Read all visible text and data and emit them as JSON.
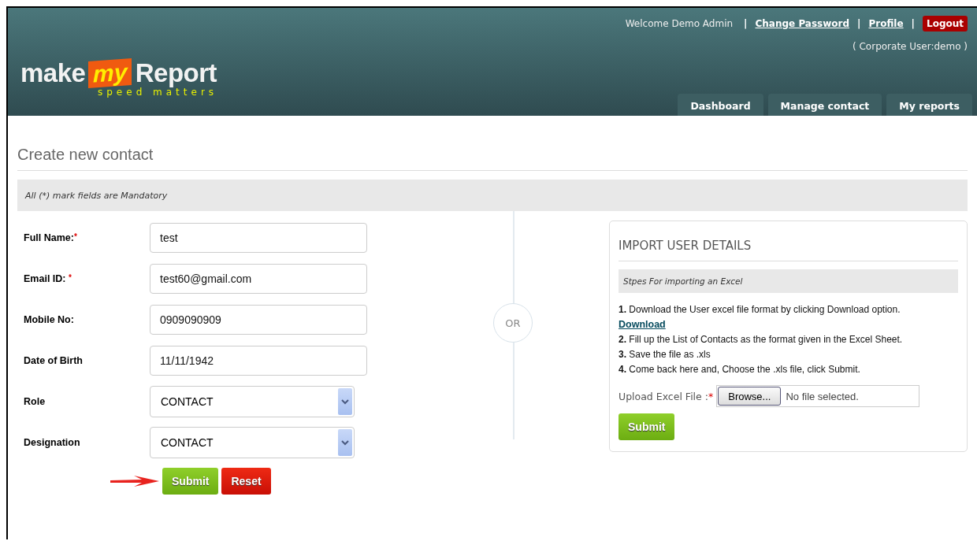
{
  "header": {
    "logo": {
      "word_1": "make",
      "word_2": "my",
      "word_3": "Report",
      "tagline": "speed matters"
    },
    "welcome": "Welcome Demo Admin",
    "links": [
      {
        "label": "Change Password",
        "kind": "link"
      },
      {
        "label": "Profile",
        "kind": "link"
      },
      {
        "label": "Logout",
        "kind": "button"
      }
    ],
    "separator": "|",
    "corporate_user": "( Corporate User:demo )",
    "tabs": [
      {
        "label": "Dashboard",
        "selected": false
      },
      {
        "label": "Manage contact",
        "selected": false
      },
      {
        "label": "My reports",
        "selected": false
      }
    ]
  },
  "form": {
    "title": "Create new contact",
    "notice": "All (*) mark fields are Mandatory",
    "fields": [
      {
        "label": "Full Name:",
        "mark": "*",
        "kind": "text",
        "value": "test"
      },
      {
        "label": "Email ID: ",
        "mark": "*",
        "kind": "text",
        "value": "test60@gmail.com"
      },
      {
        "label": "Mobile No:",
        "kind": "text",
        "value": "0909090909"
      },
      {
        "label": "Date of Birth",
        "kind": "text",
        "value": "11/11/1942"
      },
      {
        "label": "Role",
        "kind": "select",
        "value": "CONTACT"
      },
      {
        "label": "Designation",
        "kind": "select",
        "value": "CONTACT"
      }
    ],
    "buttons": [
      {
        "label": "Submit",
        "kind": "submit"
      },
      {
        "label": "Reset",
        "kind": "reset"
      }
    ]
  },
  "divider": {
    "label": "OR"
  },
  "import": {
    "title": "IMPORT USER DETAILS",
    "subtitle": "Stpes For importing an Excel",
    "steps": [
      {
        "kind": "step",
        "number": "1.",
        "text": "Download the User excel file format by clicking Download option."
      },
      {
        "kind": "link",
        "text": "Download"
      },
      {
        "kind": "step",
        "number": "2.",
        "text": "Fill up the List of Contacts as the format given in the Excel Sheet."
      },
      {
        "kind": "step",
        "number": "3.",
        "text": "Save the file as .xls"
      },
      {
        "kind": "step",
        "number": "4.",
        "text": "Come back here and, Choose the .xls file, click Submit."
      }
    ],
    "upload": {
      "label": "Upload Excel File :",
      "mark": "*",
      "browse": "Browse...",
      "status": "No file selected."
    },
    "submit": "Submit"
  }
}
